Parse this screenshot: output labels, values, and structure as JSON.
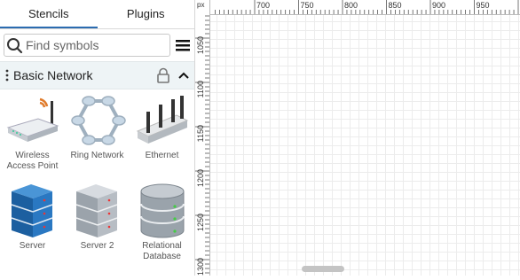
{
  "tabs": {
    "stencils": "Stencils",
    "plugins": "Plugins"
  },
  "search": {
    "placeholder": "Find symbols"
  },
  "group": {
    "title": "Basic Network"
  },
  "shapes": [
    {
      "label": "Wireless Access Point"
    },
    {
      "label": "Ring Network"
    },
    {
      "label": "Ethernet"
    },
    {
      "label": "Server"
    },
    {
      "label": "Server 2"
    },
    {
      "label": "Relational Database"
    }
  ],
  "ruler": {
    "unit": "px",
    "horizontal_ticks": [
      "700",
      "750",
      "800",
      "850",
      "900",
      "950",
      "1000"
    ],
    "vertical_ticks": [
      "1050",
      "1100",
      "1150",
      "1200",
      "1250",
      "1300"
    ]
  },
  "colors": {
    "accent": "#2b6cb0",
    "group_bg": "#eef4f6",
    "server_blue": "#1f6fb8",
    "server_gray": "#9aa3ab"
  }
}
